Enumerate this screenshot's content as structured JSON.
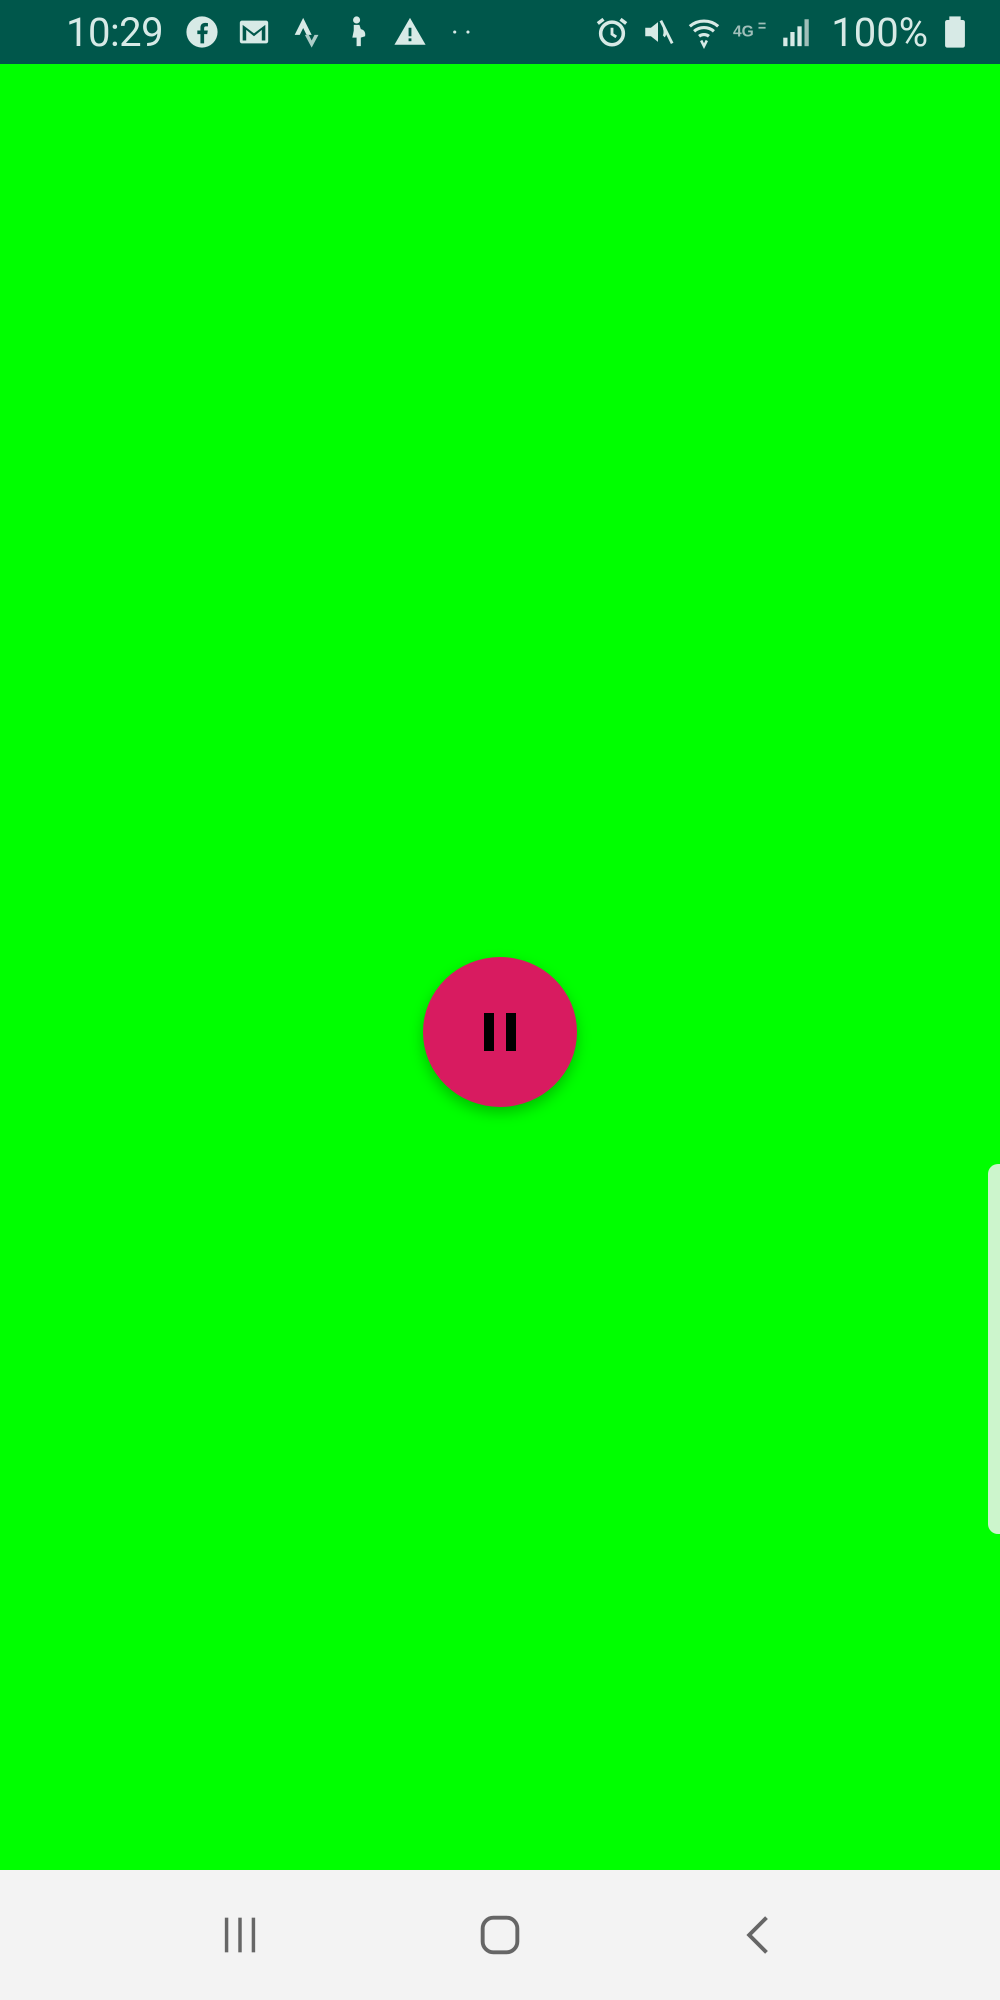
{
  "status_bar": {
    "time": "10:29",
    "battery": "100%",
    "left_icons": [
      "facebook-icon",
      "gmail-icon",
      "strava-icon",
      "pregnancy-app-icon",
      "warning-icon"
    ],
    "overflow_indicator": "··",
    "right_icons": [
      "alarm-icon",
      "mute-icon",
      "wifi-icon",
      "4g-icon",
      "signal-icon",
      "battery-icon"
    ]
  },
  "main": {
    "background_color": "#00FF00",
    "pause_button": {
      "icon": "pause-icon",
      "color": "#D81B60"
    }
  },
  "nav_bar": {
    "buttons": [
      "recent-apps-icon",
      "home-icon",
      "back-icon"
    ]
  }
}
